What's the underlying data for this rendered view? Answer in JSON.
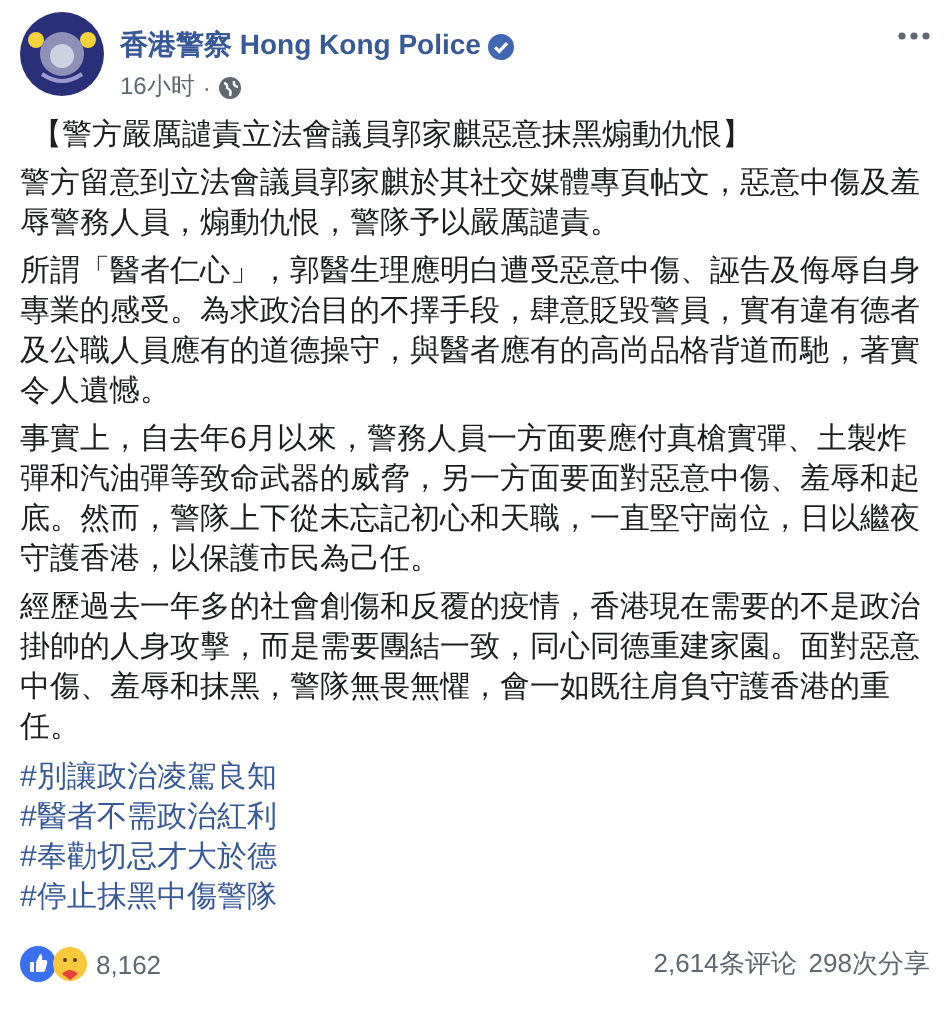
{
  "post": {
    "author": "香港警察 Hong Kong Police",
    "verified": true,
    "time": "16小时",
    "separator": "·",
    "headline": "【警方嚴厲譴責立法會議員郭家麒惡意抹黑煽動仇恨】",
    "paragraphs": [
      "警方留意到立法會議員郭家麒於其社交媒體專頁帖文，惡意中傷及羞辱警務人員，煽動仇恨，警隊予以嚴厲譴責。",
      "所謂「醫者仁心」，郭醫生理應明白遭受惡意中傷、誣告及侮辱自身專業的感受。為求政治目的不擇手段，肆意貶毀警員，實有違有德者及公職人員應有的道德操守，與醫者應有的高尚品格背道而馳，著實令人遺憾。",
      "事實上，自去年6月以來，警務人員一方面要應付真槍實彈、土製炸彈和汽油彈等致命武器的威脅，另一方面要面對惡意中傷、羞辱和起底。然而，警隊上下從未忘記初心和天職，一直堅守崗位，日以繼夜守護香港，以保護市民為己任。",
      "經歷過去一年多的社會創傷和反覆的疫情，香港現在需要的不是政治掛帥的人身攻擊，而是需要團結一致，同心同德重建家園。面對惡意中傷、羞辱和抹黑，警隊無畏無懼，會一如既往肩負守護香港的重任。"
    ],
    "hashtags": [
      "#別讓政治凌駕良知",
      "#醫者不需政治紅利",
      "#奉勸切忌才大於德",
      "#停止抹黑中傷警隊"
    ],
    "reactions_count": "8,162",
    "comments": "2,614条评论",
    "shares": "298次分享"
  }
}
